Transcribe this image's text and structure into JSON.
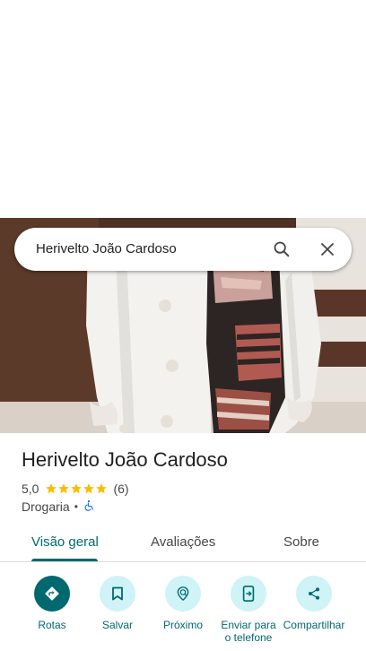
{
  "search": {
    "query": "Herivelto João Cardoso"
  },
  "place": {
    "name": "Herivelto João Cardoso",
    "rating": "5,0",
    "rating_value": 5,
    "review_count": "(6)",
    "category": "Drogaria",
    "separator": "•",
    "accessibility_icon": "wheelchair-icon"
  },
  "tabs": [
    {
      "label": "Visão geral",
      "active": true
    },
    {
      "label": "Avaliações",
      "active": false
    },
    {
      "label": "Sobre",
      "active": false
    }
  ],
  "actions": [
    {
      "label": "Rotas",
      "icon": "directions-icon"
    },
    {
      "label": "Salvar",
      "icon": "bookmark-icon"
    },
    {
      "label": "Próximo",
      "icon": "nearby-icon"
    },
    {
      "label": "Enviar para o telefone",
      "icon": "send-to-phone-icon"
    },
    {
      "label": "Compartilhar",
      "icon": "share-icon"
    }
  ],
  "colors": {
    "accent": "#00696f",
    "action_bg": "#cff3f7",
    "star": "#fbbc04",
    "text_secondary": "#444746"
  }
}
